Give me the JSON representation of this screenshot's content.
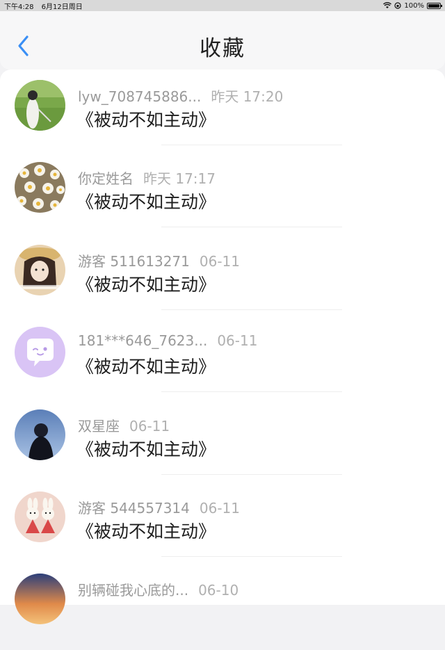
{
  "status_bar": {
    "time": "下午4:28",
    "date": "6月12日周日",
    "battery": "100%"
  },
  "nav": {
    "title": "收藏",
    "back_icon": "chevron-left-icon",
    "accent_color": "#3a8ff5"
  },
  "favorites": [
    {
      "user": "lyw_708745886...",
      "time": "昨天 17:20",
      "title": "《被动不如主动》",
      "avatar": "girl-on-grass"
    },
    {
      "user": "你定姓名",
      "time": "昨天 17:17",
      "title": "《被动不如主动》",
      "avatar": "daisy-flowers"
    },
    {
      "user": "游客 511613271",
      "time": "06-11",
      "title": "《被动不如主动》",
      "avatar": "girl-with-hat"
    },
    {
      "user": "181***646_7623...",
      "time": "06-11",
      "title": "《被动不如主动》",
      "avatar": "chat-bubble-default"
    },
    {
      "user": "双星座",
      "time": "06-11",
      "title": "《被动不如主动》",
      "avatar": "girl-at-night"
    },
    {
      "user": "游客 544557314",
      "time": "06-11",
      "title": "《被动不如主动》",
      "avatar": "bunny-toys"
    },
    {
      "user": "别辆碰我心底的...",
      "time": "06-10",
      "title": "",
      "avatar": "sunset-sky"
    }
  ]
}
